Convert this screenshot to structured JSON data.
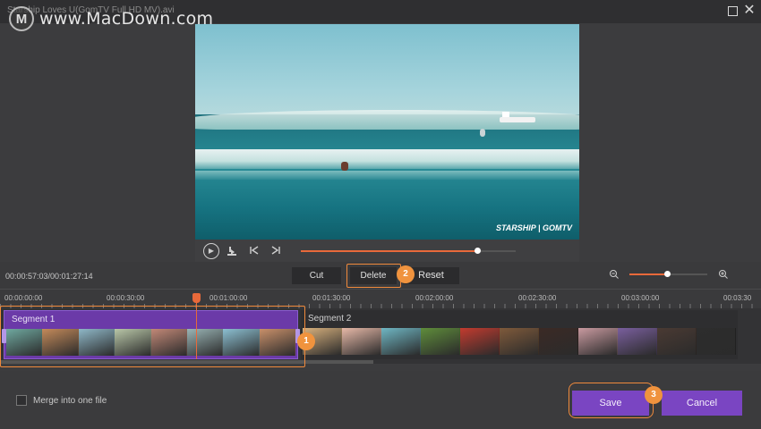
{
  "window": {
    "title": "Starship Loves U(GomTV Full HD MV).avi",
    "maximize_icon": "maximize-icon",
    "close_icon": "close-icon"
  },
  "watermark": {
    "logo_letter": "M",
    "text": "www.MacDown.com"
  },
  "video": {
    "logo_text": "STARSHIP | GOMTV"
  },
  "playback": {
    "icons": [
      "play-icon",
      "snapshot-icon",
      "previous-frame-icon",
      "next-frame-icon"
    ],
    "progress": 0.82
  },
  "toolbar": {
    "timecode": "00:00:57:03/00:01:27:14",
    "cut_label": "Cut",
    "delete_label": "Delete",
    "reset_label": "Reset",
    "zoom_level": 0.48,
    "badge_delete": "2"
  },
  "ruler": {
    "labels": [
      "00:00:00:00",
      "00:00:30:00",
      "00:01:00:00",
      "00:01:30:00",
      "00:02:00:00",
      "00:02:30:00",
      "00:03:00:00",
      "00:03:30"
    ]
  },
  "timeline": {
    "segment1_label": "Segment 1",
    "segment2_label": "Segment 2",
    "badge_segment": "1",
    "thumb_colors_1": [
      "#6fa9a0",
      "#c48a5a",
      "#8fb8c8",
      "#b9c7a8",
      "#c28877",
      "#9ab5b6",
      "#8cc0d2",
      "#c9906a"
    ],
    "thumb_colors_2": [
      "#d9b27e",
      "#e7b9a8",
      "#6fb7c4",
      "#5f8d3b",
      "#c33b2f",
      "#7f5a3b",
      "#3b2a25",
      "#c99aa0",
      "#7a5f9e",
      "#4a3a33",
      "#2d2d2d"
    ]
  },
  "bottom": {
    "merge_label": "Merge into one file",
    "save_label": "Save",
    "cancel_label": "Cancel",
    "badge_save": "3"
  },
  "colors": {
    "accent": "#e8693a",
    "purple": "#7a45c2",
    "highlight": "#f08a3c"
  }
}
